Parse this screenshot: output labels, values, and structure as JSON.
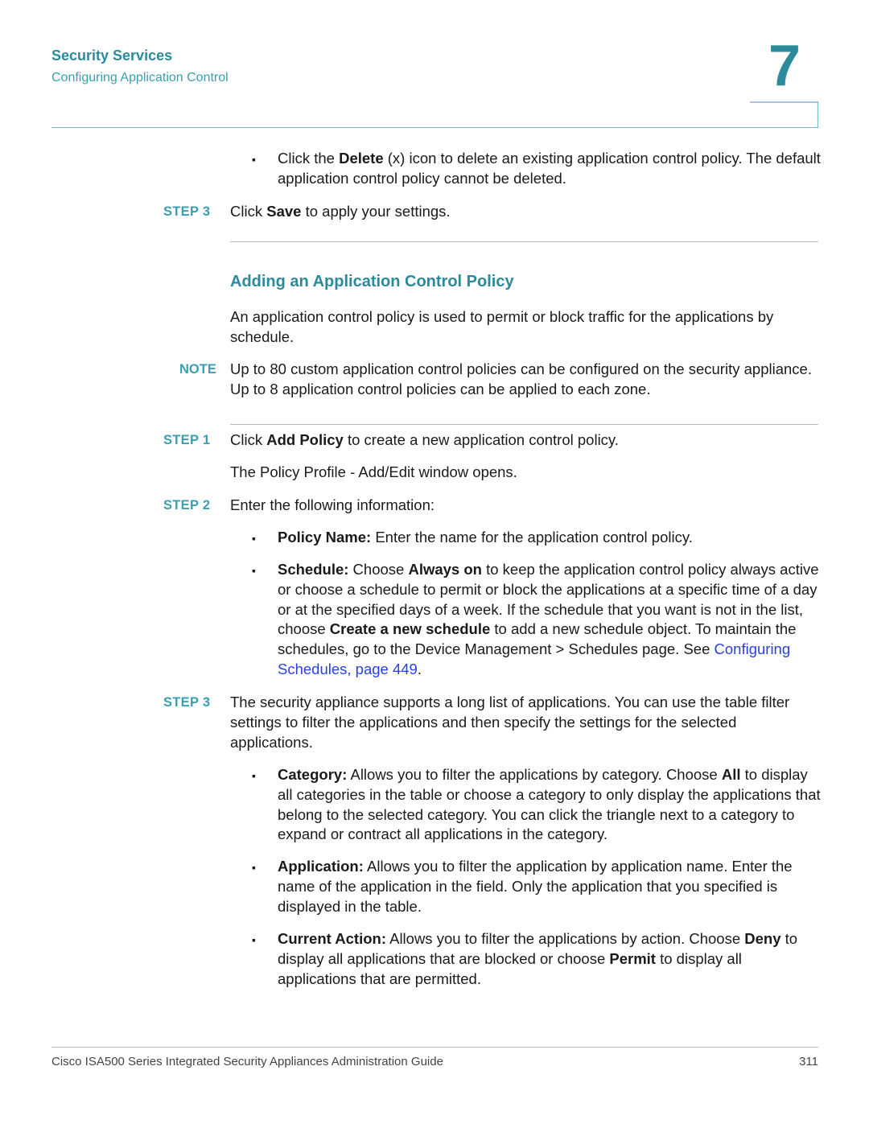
{
  "header": {
    "chapter_title": "Security Services",
    "section_subtitle": "Configuring Application Control",
    "chapter_number": "7"
  },
  "top_bullet": {
    "pre": "Click the ",
    "bold": "Delete",
    "post": " (x) icon to delete an existing application control policy. The default application control policy cannot be deleted."
  },
  "step3_save": {
    "label": "STEP 3",
    "pre": "Click ",
    "bold": "Save",
    "post": " to apply your settings."
  },
  "section": {
    "title": "Adding an Application Control Policy",
    "intro": "An application control policy is used to permit or block traffic for the applications by schedule.",
    "note_label": "NOTE",
    "note_text": "Up to 80 custom application control policies can be configured on the security appliance. Up to 8 application control policies can be applied to each zone."
  },
  "steps": {
    "step1": {
      "label": "STEP 1",
      "pre": "Click ",
      "bold": "Add Policy",
      "post": " to create a new application control policy.",
      "followup": "The Policy Profile - Add/Edit window opens."
    },
    "step2": {
      "label": "STEP 2",
      "text": "Enter the following information:",
      "bullets": {
        "policy_name": {
          "term": "Policy Name:",
          "text": " Enter the name for the application control policy."
        },
        "schedule": {
          "term": "Schedule:",
          "t1": " Choose ",
          "b1": "Always on",
          "t2": " to keep the application control policy always active or choose a schedule to permit or block the applications at a specific time of a day or at the specified days of a week. If the schedule that you want is not in the list, choose ",
          "b2": "Create a new schedule",
          "t3": " to add a new schedule object. To maintain the schedules, go to the Device Management > Schedules page. See ",
          "link": "Configuring Schedules, page 449",
          "t4": "."
        }
      }
    },
    "step3": {
      "label": "STEP 3",
      "text": "The security appliance supports a long list of applications. You can use the table filter settings to filter the applications and then specify the settings for the selected applications.",
      "bullets": {
        "category": {
          "term": "Category:",
          "t1": " Allows you to filter the applications by category. Choose ",
          "b1": "All",
          "t2": " to display all categories in the table or choose a category to only display the applications that belong to the selected category. You can click the triangle next to a category to expand or contract all applications in the category."
        },
        "application": {
          "term": "Application:",
          "t1": " Allows you to filter the application by application name. Enter the name of the application in the field. Only the application that you specified is displayed in the table."
        },
        "current_action": {
          "term": "Current Action:",
          "t1": " Allows you to filter the applications by action. Choose ",
          "b1": "Deny",
          "t2": " to display all applications that are blocked or choose ",
          "b2": "Permit",
          "t3": " to display all applications that are permitted."
        }
      }
    }
  },
  "footer": {
    "guide_title": "Cisco ISA500 Series Integrated Security Appliances Administration Guide",
    "page_number": "311"
  },
  "colors": {
    "accent": "#2b8a9c",
    "link": "#2a3fe0",
    "text": "#1a1a1a"
  }
}
